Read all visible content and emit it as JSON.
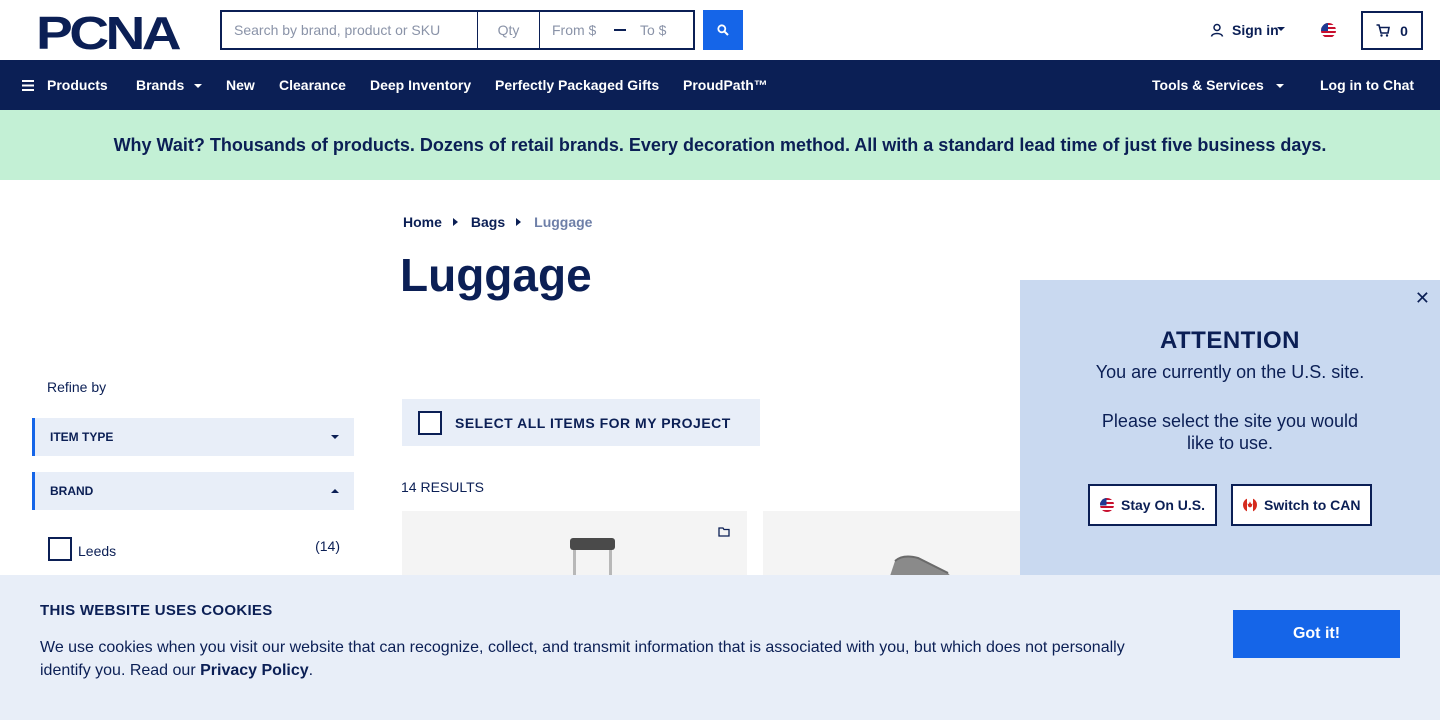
{
  "header": {
    "logo_text": "PCNA",
    "search_placeholder": "Search by brand, product or SKU",
    "qty_placeholder": "Qty",
    "from_placeholder": "From $",
    "to_placeholder": "To $",
    "sign_in": "Sign in",
    "cart_count": "0"
  },
  "nav": {
    "products": "Products",
    "brands": "Brands",
    "new": "New",
    "clearance": "Clearance",
    "deep_inventory": "Deep Inventory",
    "gifts": "Perfectly Packaged Gifts",
    "proudpath": "ProudPath™",
    "tools": "Tools & Services",
    "chat": "Log in to Chat"
  },
  "promo": "Why Wait? Thousands of products. Dozens of retail brands. Every decoration method. All with a standard lead time of just five business days.",
  "breadcrumb": [
    "Home",
    "Bags",
    "Luggage"
  ],
  "page_title": "Luggage",
  "sidebar": {
    "refine": "Refine by",
    "facets": [
      "ITEM TYPE",
      "BRAND"
    ],
    "brand_options": [
      {
        "name": "Leeds",
        "count": "(14)"
      }
    ]
  },
  "select_all": "SELECT ALL ITEMS FOR MY PROJECT",
  "results": "14 RESULTS",
  "modal": {
    "title": "ATTENTION",
    "message": "You are currently on the U.S. site.",
    "prompt": "Please select the site you would like to use.",
    "stay": "Stay On U.S.",
    "switch": "Switch to CAN"
  },
  "cookie": {
    "title": "THIS WEBSITE USES COOKIES",
    "text": "We use cookies when you visit our website that can recognize, collect, and transmit information that is associated with you, but which does not personally identify you. Read our",
    "link": "Privacy Policy",
    "period": ".",
    "button": "Got it!"
  },
  "colors": {
    "navy": "#0b1f55",
    "blue": "#1565e8",
    "promo_bg": "#c3f0d5",
    "modal_bg": "#c9d9f0",
    "light_bg": "#e8eef8"
  }
}
